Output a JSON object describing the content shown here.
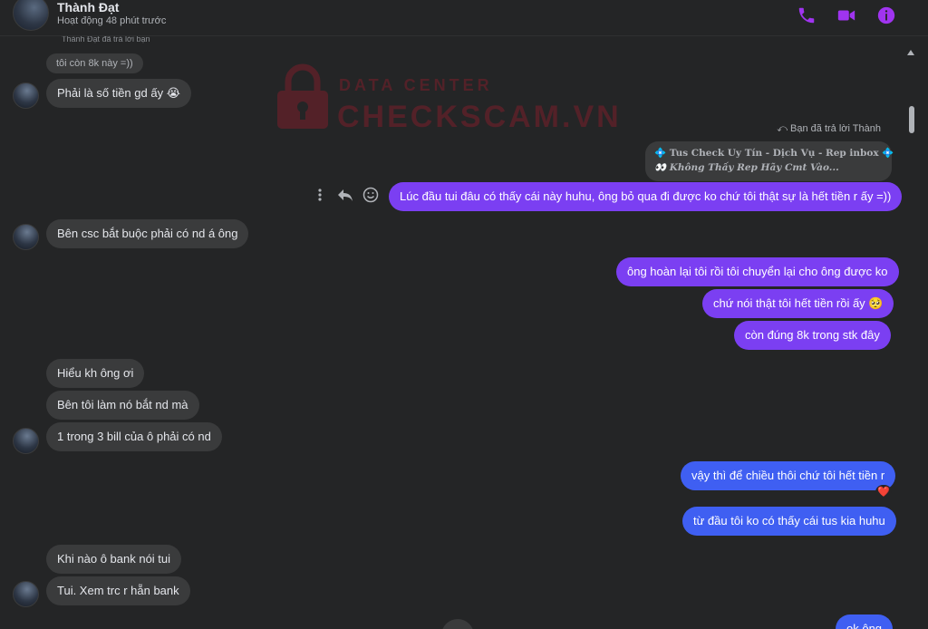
{
  "header": {
    "name": "Thành Đạt",
    "status": "Hoạt động 48 phút trước",
    "icons": [
      "phone-icon",
      "video-icon",
      "info-icon"
    ],
    "accent_color": "#a034f0"
  },
  "watermark": {
    "top": "DATA CENTER",
    "main": "CHECKSCAM.VN"
  },
  "messages": {
    "faded_reply_label": "Thành Đạt đã trả lời bạn",
    "m0": "tôi còn 8k này =))",
    "m1": "Phải là số tiền gd ấy 😭",
    "reply_hint": "Bạn đã trả lời Thành",
    "quoted_l1": "💠 Tus Check Uy Tín - Dịch Vụ - Rep inbox 💠",
    "quoted_l2": "👀 Không Thấy Rep Hãy Cmt Vào...",
    "m2": "Lúc đầu tui đâu có thấy cái này huhu, ông bỏ qua đi được ko chứ tôi thật sự là hết tiền r ấy =))",
    "m3": "Bên csc bắt buộc phải có nd á ông",
    "m4": "ông hoàn lại tôi rồi tôi chuyển lại cho ông được ko",
    "m5": "chứ nói thật tôi hết tiền rồi ấy 🥺",
    "m6": "còn đúng 8k trong stk đây",
    "m7": "Hiểu kh ông ơi",
    "m8": "Bên tôi làm nó bắt nd mà",
    "m9": "1 trong 3 bill của ô phải có nd",
    "m10": "vậy thì để chiều thôi chứ tôi hết tiền r",
    "m10_reaction": "❤️",
    "m11": "từ đầu tôi ko có thấy cái tus kia huhu",
    "m12": "Khi nào ô bank nói tui",
    "m13": "Tui. Xem trc r hẵn bank",
    "m14": "ok ông"
  },
  "colors": {
    "bubble_incoming": "#3a3b3c",
    "bubble_outgoing_purple": "#7b3ff2",
    "bubble_outgoing_blue": "#3f5ff2",
    "background": "#242526"
  }
}
